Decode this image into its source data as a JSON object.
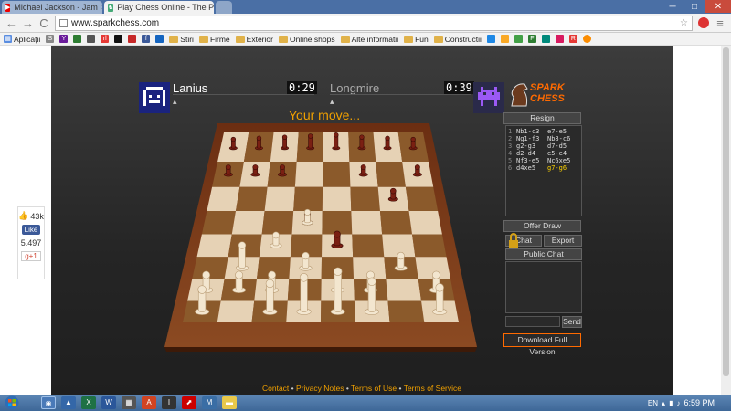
{
  "tabs": [
    {
      "label": "Michael Jackson - Jam",
      "close": "×"
    },
    {
      "label": "Play Chess Online - The P",
      "close": "×"
    }
  ],
  "window": {
    "minimize": "─",
    "maximize": "□",
    "close": "✕"
  },
  "omnibar": {
    "back": "←",
    "forward": "→",
    "reload": "C",
    "url": "www.sparkchess.com",
    "star": "☆",
    "menu": "≡"
  },
  "bookmarks": [
    "Aplicații",
    "S",
    "Y",
    "",
    "",
    "rl",
    "",
    "",
    "f",
    "",
    "Stiri",
    "Firme",
    "Exterior",
    "Online shops",
    "Alte informatii",
    "Fun",
    "Constructii",
    "",
    "",
    "",
    "F",
    "",
    "",
    "R",
    ""
  ],
  "social": {
    "count": "43k",
    "like": "Like",
    "plus_count": "5.497",
    "gplus": "g+1"
  },
  "game": {
    "player1": "Lanius",
    "timer1": "0:29",
    "player2": "Longmire",
    "timer2": "0:39",
    "status": "Your move...",
    "logo_top": "SPARK",
    "logo_bottom": "CHESS",
    "resign": "Resign",
    "offer_draw": "Offer Draw",
    "btn_chat": "Chat",
    "btn_export": "Export PGN",
    "btn_public_chat": "Public Chat",
    "btn_send": "Send",
    "download": "Download Full Version",
    "moves": [
      {
        "n": "1",
        "w": "Nb1-c3",
        "b": "e7-e5"
      },
      {
        "n": "2",
        "w": "Ng1-f3",
        "b": "Nb8-c6"
      },
      {
        "n": "3",
        "w": "g2-g3",
        "b": "d7-d5"
      },
      {
        "n": "4",
        "w": "d2-d4",
        "b": "e5-e4"
      },
      {
        "n": "5",
        "w": "Nf3-e5",
        "b": "Nc6xe5"
      },
      {
        "n": "6",
        "w": "d4xe5",
        "b": "g7-g6"
      }
    ]
  },
  "footer": {
    "contact": "Contact",
    "privacy": "Privacy Notes",
    "terms_use": "Terms of Use",
    "terms_service": "Terms of Service",
    "sep": "•"
  },
  "taskbar": {
    "lang": "EN",
    "time": "6:59 PM"
  },
  "colors": {
    "accent": "#f0a000",
    "board_light": "#e6d2b5",
    "board_dark": "#8b5a2b",
    "frame": "#6b2e12"
  }
}
